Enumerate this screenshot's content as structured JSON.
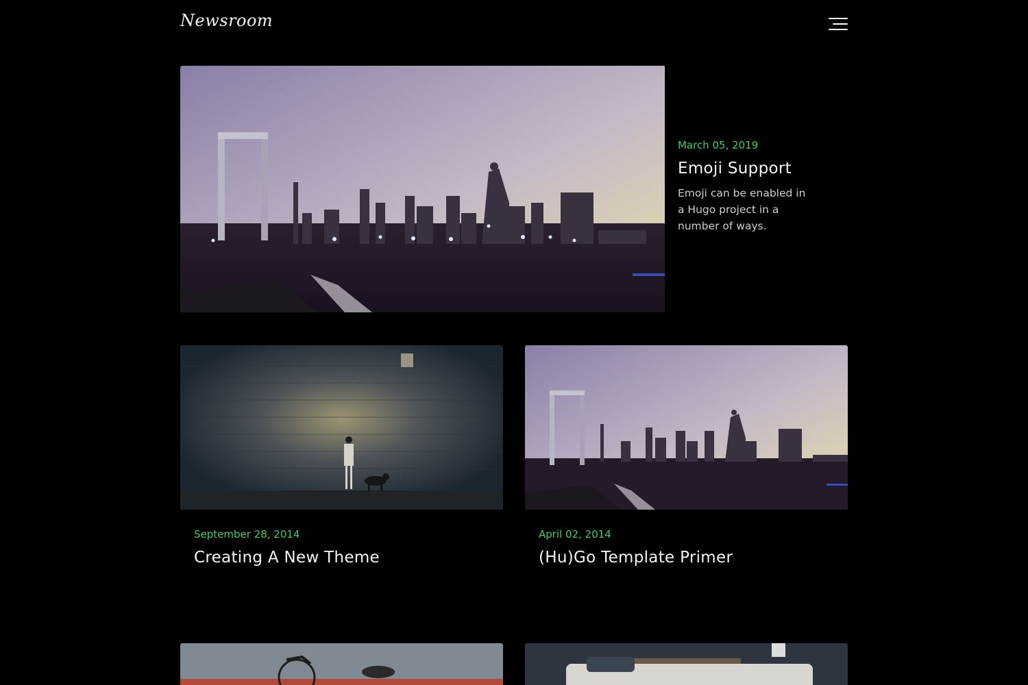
{
  "header": {
    "logo": "Newsroom",
    "menu_icon": "hamburger-menu-icon"
  },
  "featured": {
    "date": "March 05, 2019",
    "title": "Emoji Support",
    "summary": "Emoji can be enabled in a Hugo project in a number of ways.",
    "image": "city-skyline-dusk"
  },
  "posts": [
    {
      "date": "September 28, 2014",
      "title": "Creating A New Theme",
      "image": "person-dog-spotlight-wall"
    },
    {
      "date": "April 02, 2014",
      "title": "(Hu)Go Template Primer",
      "image": "city-skyline-dusk"
    },
    {
      "image": "bicycle-by-water"
    },
    {
      "image": "living-room-sofa"
    }
  ],
  "colors": {
    "background": "#000000",
    "accent_date": "#3ecf6a",
    "title": "#f4f4f4"
  }
}
